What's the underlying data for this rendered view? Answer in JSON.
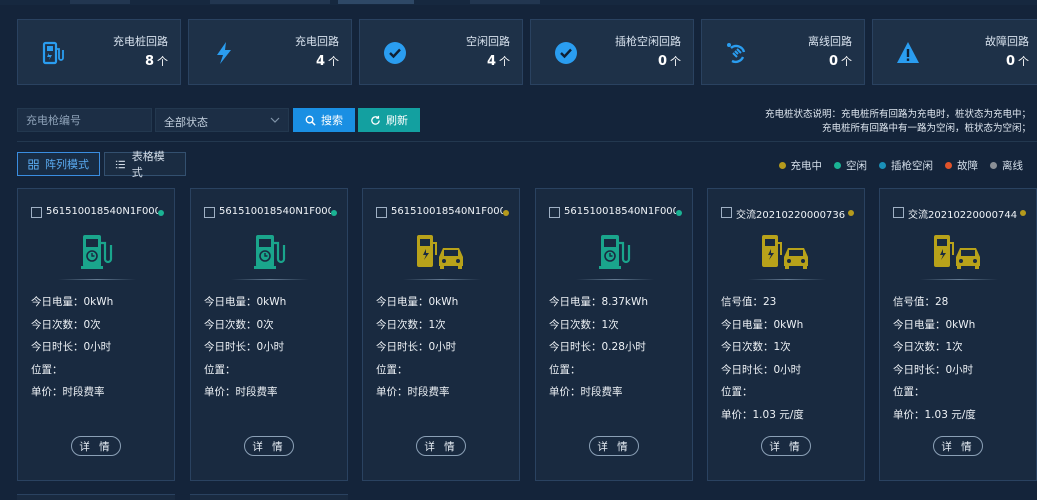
{
  "stats": [
    {
      "label": "充电桩回路",
      "value": "8",
      "unit": "个",
      "icon": "charger-pile-icon"
    },
    {
      "label": "充电回路",
      "value": "4",
      "unit": "个",
      "icon": "lightning-icon"
    },
    {
      "label": "空闲回路",
      "value": "4",
      "unit": "个",
      "icon": "check-circle-icon"
    },
    {
      "label": "插枪空闲回路",
      "value": "0",
      "unit": "个",
      "icon": "check-circle-icon"
    },
    {
      "label": "离线回路",
      "value": "0",
      "unit": "个",
      "icon": "plug-offline-icon"
    },
    {
      "label": "故障回路",
      "value": "0",
      "unit": "个",
      "icon": "warning-triangle-icon"
    }
  ],
  "toolbar": {
    "search_placeholder": "充电枪编号",
    "status_value": "全部状态",
    "search_label": "搜索",
    "refresh_label": "刷新",
    "note_line1": "充电桩状态说明：充电桩所有回路为充电时，桩状态为充电中；",
    "note_line2": "充电桩所有回路中有一路为空闲，桩状态为空闲；"
  },
  "modes": {
    "grid_label": "阵列模式",
    "table_label": "表格模式"
  },
  "legend": [
    {
      "label": "充电中",
      "color": "#b59a1c"
    },
    {
      "label": "空闲",
      "color": "#1ab394"
    },
    {
      "label": "插枪空闲",
      "color": "#1a90b8"
    },
    {
      "label": "故障",
      "color": "#e0532a"
    },
    {
      "label": "离线",
      "color": "#8a8f96"
    }
  ],
  "cards": [
    {
      "title": "561510018540N1F000…",
      "status_color": "#1ab394",
      "pic": "charger-idle-icon",
      "pic_color": "#1aa58c",
      "lines": [
        "今日电量：0kWh",
        "今日次数：0次",
        "今日时长：0小时",
        "位置：",
        "单价：时段费率"
      ],
      "detail_label": "详 情"
    },
    {
      "title": "561510018540N1F000…",
      "status_color": "#1ab394",
      "pic": "charger-idle-icon",
      "pic_color": "#1aa58c",
      "lines": [
        "今日电量：0kWh",
        "今日次数：0次",
        "今日时长：0小时",
        "位置：",
        "单价：时段费率"
      ],
      "detail_label": "详 情"
    },
    {
      "title": "561510018540N1F000…",
      "status_color": "#b59a1c",
      "pic": "charger-car-icon",
      "pic_color": "#b8a21a",
      "lines": [
        "今日电量：0kWh",
        "今日次数：1次",
        "今日时长：0小时",
        "位置：",
        "单价：时段费率"
      ],
      "detail_label": "详 情"
    },
    {
      "title": "561510018540N1F000…",
      "status_color": "#1ab394",
      "pic": "charger-idle-icon",
      "pic_color": "#1aa58c",
      "lines": [
        "今日电量：8.37kWh",
        "今日次数：1次",
        "今日时长：0.28小时",
        "位置：",
        "单价：时段费率"
      ],
      "detail_label": "详 情"
    },
    {
      "title": "交流20210220000736",
      "status_color": "#b59a1c",
      "pic": "charger-car-icon",
      "pic_color": "#b8a21a",
      "lines": [
        "信号值：23",
        "今日电量：0kWh",
        "今日次数：1次",
        "今日时长：0小时",
        "位置：",
        "单价：1.03 元/度"
      ],
      "detail_label": "详 情"
    },
    {
      "title": "交流20210220000744",
      "status_color": "#b59a1c",
      "pic": "charger-car-icon",
      "pic_color": "#b8a21a",
      "lines": [
        "信号值：28",
        "今日电量：0kWh",
        "今日次数：1次",
        "今日时长：0小时",
        "位置：",
        "单价：1.03 元/度"
      ],
      "detail_label": "详 情"
    }
  ]
}
